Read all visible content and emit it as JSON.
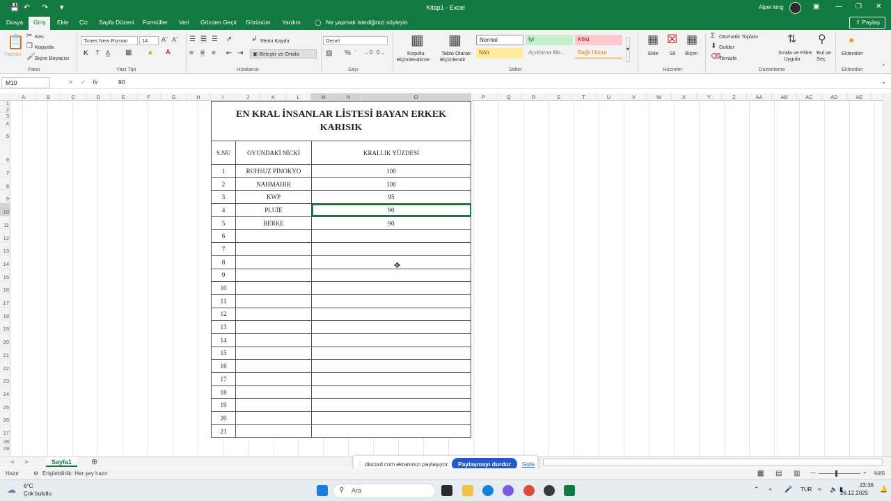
{
  "titlebar": {
    "doc_title": "Kitap1 - Excel",
    "user_name": "Alper king"
  },
  "ribbon_tabs": [
    "Dosya",
    "Giriş",
    "Ekle",
    "Çiz",
    "Sayfa Düzeni",
    "Formüller",
    "Veri",
    "Gözden Geçir",
    "Görünüm",
    "Yardım"
  ],
  "tell_me": "Ne yapmak istediğinizi söyleyin",
  "share_label": "Paylaş",
  "ribbon": {
    "paste": "Yapıştır",
    "cut": "Kes",
    "copy": "Kopyala",
    "format_painter": "Biçim Boyacısı",
    "group_clipboard": "Pano",
    "font_name": "Times New Roman",
    "font_size": "14",
    "bold": "K",
    "italic": "T",
    "underline": "A",
    "group_font": "Yazı Tipi",
    "wrap_text": "Metni Kaydır",
    "merge_center": "Birleştir ve Ortala",
    "group_alignment": "Hizalama",
    "number_format": "Genel",
    "percent": "%",
    "group_number": "Sayı",
    "conditional": [
      "Koşullu",
      "Biçimlendirme"
    ],
    "format_table": [
      "Tablo Olarak",
      "Biçimlendir"
    ],
    "styles": {
      "normal": "Normal",
      "good": "İyi",
      "bad": "Kötü",
      "neutral": "Nötr",
      "explanatory": "Açıklama Me...",
      "linked": "Bağlı Hücre"
    },
    "group_styles": "Stiller",
    "insert": "Ekle",
    "delete": "Sil",
    "format": "Biçim",
    "group_cells": "Hücreler",
    "autosum": "Otomatik Toplam",
    "fill": "Doldur",
    "clear": "Temizle",
    "sort_filter": [
      "Sırala ve Filtre",
      "Uygula"
    ],
    "find_select": [
      "Bul ve",
      "Seç"
    ],
    "group_editing": "Düzenleme",
    "addins": "Eklentiler",
    "group_addins": "Eklentiler"
  },
  "formula_bar": {
    "name_box": "M10",
    "fx": "fx",
    "value": "90"
  },
  "columns": [
    "A",
    "B",
    "C",
    "D",
    "E",
    "F",
    "G",
    "H",
    "I",
    "J",
    "K",
    "L",
    "M",
    "N",
    "O",
    "P",
    "Q",
    "R",
    "S",
    "T",
    "U",
    "V",
    "W",
    "X",
    "Y",
    "Z",
    "AA",
    "AB",
    "AC",
    "AD",
    "AE"
  ],
  "rows": [
    "1",
    "2",
    "3",
    "4",
    "5",
    "6",
    "7",
    "8",
    "9",
    "10",
    "11",
    "12",
    "13",
    "14",
    "15",
    "16",
    "17",
    "18",
    "19",
    "20",
    "21",
    "22",
    "23",
    "24",
    "25",
    "26",
    "27",
    "28",
    "29"
  ],
  "sheet_table": {
    "title_line1": "EN KRAL İNSANLAR LİSTESİ BAYAN ERKEK",
    "title_line2": "KARISIK",
    "headers": [
      "S.NU",
      "OYUNDAKİ NİCKİ",
      "KRALLIK YÜZDESİ"
    ],
    "rows": [
      [
        "1",
        "RUHSUZ PİNOKYO",
        "100"
      ],
      [
        "2",
        "NAHMAHIR",
        "100"
      ],
      [
        "3",
        "KWP",
        "95"
      ],
      [
        "4",
        "PLUİE",
        "90"
      ],
      [
        "5",
        "BERKE",
        "90"
      ],
      [
        "6",
        "",
        ""
      ],
      [
        "7",
        "",
        ""
      ],
      [
        "8",
        "",
        ""
      ],
      [
        "9",
        "",
        ""
      ],
      [
        "10",
        "",
        ""
      ],
      [
        "11",
        "",
        ""
      ],
      [
        "12",
        "",
        ""
      ],
      [
        "13",
        "",
        ""
      ],
      [
        "14",
        "",
        ""
      ],
      [
        "15",
        "",
        ""
      ],
      [
        "16",
        "",
        ""
      ],
      [
        "17",
        "",
        ""
      ],
      [
        "18",
        "",
        ""
      ],
      [
        "19",
        "",
        ""
      ],
      [
        "20",
        "",
        ""
      ],
      [
        "21",
        "",
        ""
      ]
    ]
  },
  "sheet_tab": "Sayfa1",
  "share_banner": {
    "message": "discord.com ekranınızı paylaşıyor.",
    "stop": "Paylaşmayı durdur",
    "hide": "Gizle"
  },
  "status": {
    "ready": "Hazır",
    "accessibility": "Erişilebilirlik: Her şey hazır",
    "zoom": "%85"
  },
  "taskbar": {
    "weather_temp": "6°C",
    "weather_desc": "Çok bulutlu",
    "search": "Ara",
    "lang": "TUR",
    "time": "23:36",
    "date": "26.12.2025"
  },
  "colors": {
    "excel_green": "#127a3f",
    "discord_blue": "#2558c9"
  }
}
